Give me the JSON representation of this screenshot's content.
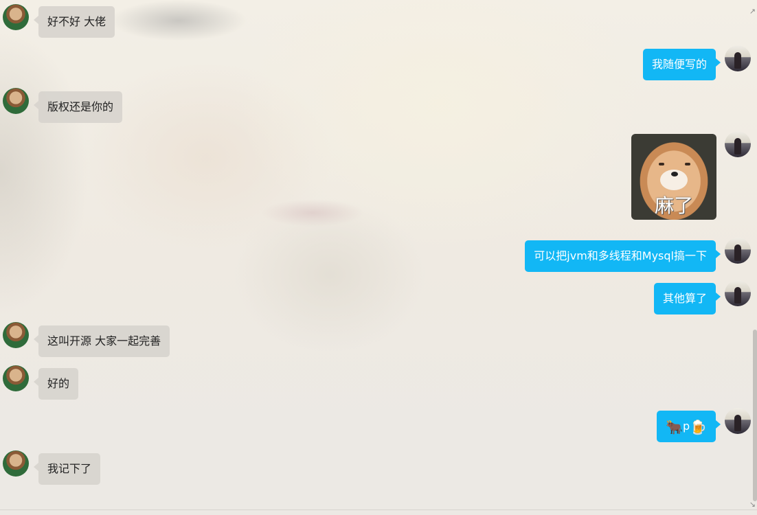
{
  "messages": [
    {
      "side": "left",
      "text": "好不好 大佬"
    },
    {
      "side": "right",
      "text": "我随便写的"
    },
    {
      "side": "left",
      "text": "版权还是你的"
    },
    {
      "side": "right",
      "type": "sticker",
      "sticker_caption": "麻了"
    },
    {
      "side": "right",
      "text": "可以把jvm和多线程和Mysql搞一下"
    },
    {
      "side": "right",
      "text": "其他算了"
    },
    {
      "side": "left",
      "text": "这叫开源  大家一起完善"
    },
    {
      "side": "left",
      "text": "好的"
    },
    {
      "side": "right",
      "type": "emoji",
      "emoji_1": "🐂",
      "text_between": "p",
      "emoji_2": "🍺"
    },
    {
      "side": "left",
      "text": "我记下了"
    }
  ],
  "colors": {
    "self_bubble": "#12b7f5",
    "peer_bubble": "#d6d3cd",
    "background": "#ece9e4"
  },
  "icons": {
    "peer_avatar": "avatar-icon",
    "self_avatar": "avatar-icon",
    "scroll_up": "arrow-up-icon",
    "scroll_down": "arrow-down-icon"
  }
}
